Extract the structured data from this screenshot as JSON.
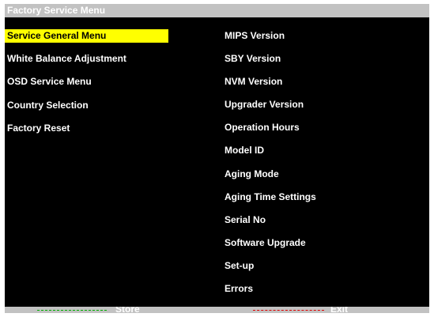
{
  "title": "Factory Service Menu",
  "left_menu": [
    {
      "label": "Service General Menu",
      "selected": true
    },
    {
      "label": "White Balance Adjustment",
      "selected": false
    },
    {
      "label": "OSD Service Menu",
      "selected": false
    },
    {
      "label": "Country Selection",
      "selected": false
    },
    {
      "label": "Factory Reset",
      "selected": false
    }
  ],
  "right_menu": [
    "MIPS Version",
    "SBY Version",
    "NVM Version",
    "Upgrader Version",
    "Operation Hours",
    "Model ID",
    "Aging Mode",
    "Aging Time Settings",
    "Serial No",
    "Software Upgrade",
    "Set-up",
    "Errors"
  ],
  "footer": {
    "store_label": "Store",
    "exit_label": "Exit",
    "store_color": "#00b000",
    "exit_color": "#e00000"
  },
  "colors": {
    "background": "#000000",
    "bar": "#c2c2c2",
    "highlight": "#ffff00"
  }
}
